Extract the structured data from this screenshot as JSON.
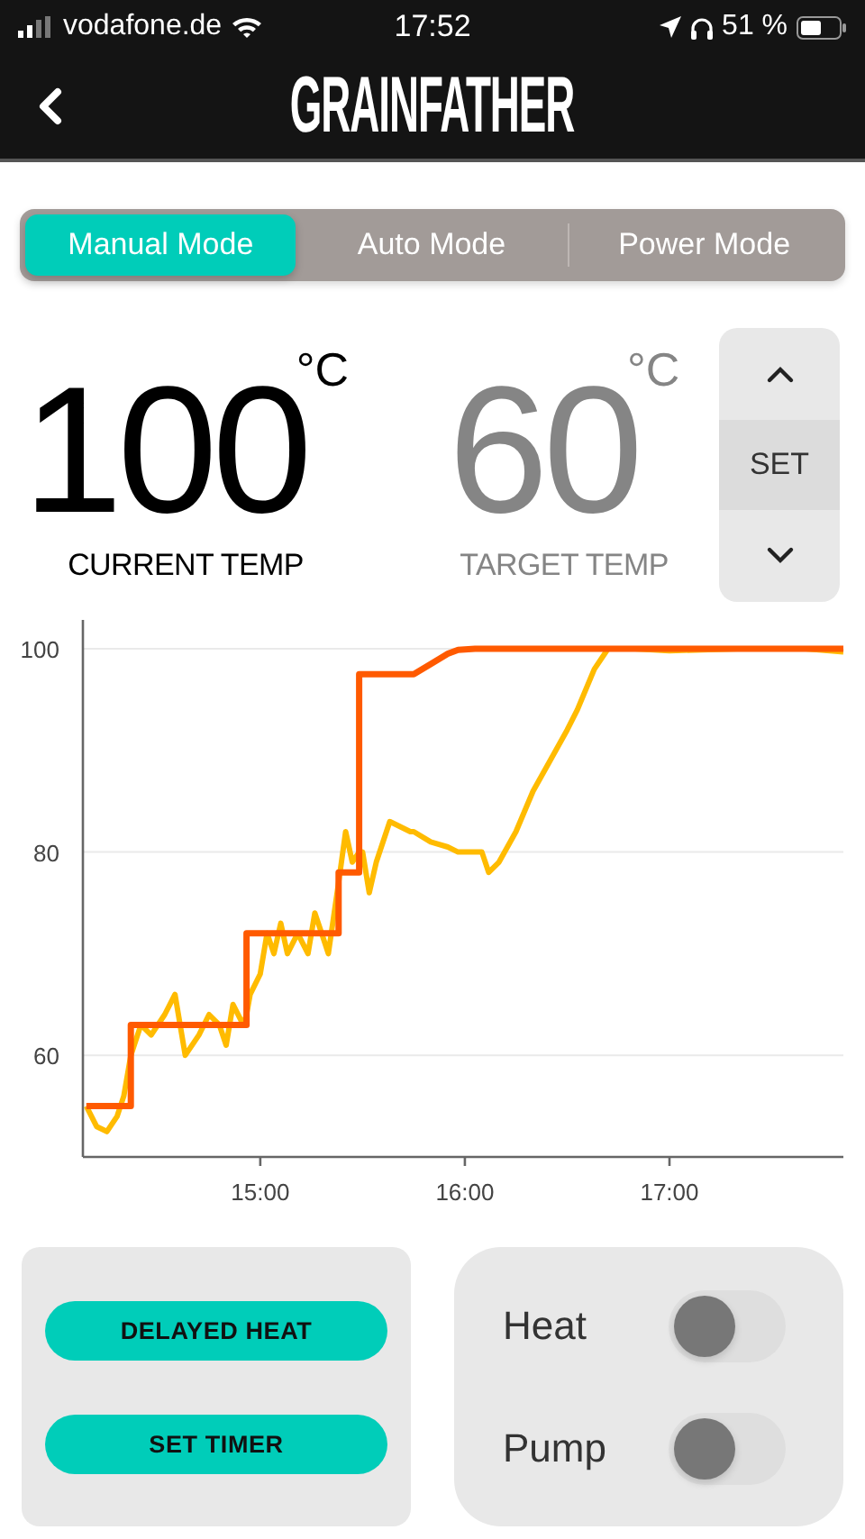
{
  "status_bar": {
    "carrier": "vodafone.de",
    "time": "17:52",
    "battery": "51 %"
  },
  "header": {
    "title": "GRAINFATHER"
  },
  "mode_tabs": [
    {
      "label": "Manual Mode",
      "selected": true
    },
    {
      "label": "Auto Mode",
      "selected": false
    },
    {
      "label": "Power Mode",
      "selected": false
    }
  ],
  "current": {
    "value": "100",
    "unit": "°C",
    "label": "CURRENT TEMP"
  },
  "target": {
    "value": "60",
    "unit": "°C",
    "label": "TARGET TEMP"
  },
  "setter": {
    "button": "SET"
  },
  "chart": {
    "chart_data": {
      "type": "line",
      "x": [
        14.15,
        14.2,
        14.25,
        14.3,
        14.333,
        14.367,
        14.367,
        14.417,
        14.467,
        14.533,
        14.583,
        14.633,
        14.7,
        14.75,
        14.8,
        14.833,
        14.867,
        14.917,
        14.933,
        14.933,
        14.95,
        15,
        15.033,
        15.067,
        15.1,
        15.133,
        15.183,
        15.233,
        15.267,
        15.3,
        15.333,
        15.383,
        15.383,
        15.417,
        15.45,
        15.483,
        15.483,
        15.5,
        15.533,
        15.567,
        15.633,
        15.733,
        15.75,
        15.833,
        15.917,
        15.967,
        16.05,
        16.083,
        16.117,
        16.167,
        16.25,
        16.333,
        16.417,
        16.5,
        16.55,
        16.633,
        16.7,
        16.833,
        17,
        17.333,
        17.667,
        17.85
      ],
      "series": [
        {
          "color": "#ffbb00",
          "values": [
            55,
            53,
            52.5,
            54,
            56,
            60,
            60,
            63,
            62,
            64,
            66,
            60,
            62,
            64,
            63,
            61,
            65,
            63,
            64,
            64,
            66,
            68,
            72,
            70,
            73,
            70,
            72,
            70,
            74,
            72,
            70,
            77,
            77,
            82,
            79,
            80,
            80,
            80,
            76,
            79,
            83,
            82,
            82,
            81,
            80.5,
            80,
            80,
            80,
            78,
            79,
            82,
            86,
            89,
            92,
            94,
            98,
            100,
            100,
            99.8,
            100,
            100,
            99.7
          ]
        },
        {
          "color": "#ff5a00",
          "values": [
            55,
            55,
            55,
            55,
            55,
            55,
            63,
            63,
            63,
            63,
            63,
            63,
            63,
            63,
            63,
            63,
            63,
            63,
            63,
            72,
            72,
            72,
            72,
            72,
            72,
            72,
            72,
            72,
            72,
            72,
            72,
            72,
            78,
            78,
            78,
            78,
            97.5,
            97.5,
            97.5,
            97.5,
            97.5,
            97.5,
            97.5,
            98.5,
            99.5,
            99.9,
            100,
            100,
            100,
            100,
            100,
            100,
            100,
            100,
            100,
            100,
            100,
            100,
            100,
            100,
            100,
            100
          ]
        }
      ],
      "xlim": [
        14.133,
        17.85
      ],
      "ylim": [
        50,
        102.8
      ],
      "xticks": [
        {
          "value": 15,
          "label": "15:00"
        },
        {
          "value": 16,
          "label": "16:00"
        },
        {
          "value": 17,
          "label": "17:00"
        }
      ],
      "yticks": [
        60,
        80,
        100
      ],
      "grid": true
    }
  },
  "buttons": [
    "DELAYED HEAT",
    "SET TIMER"
  ],
  "switches": [
    {
      "label": "Heat",
      "on": false
    },
    {
      "label": "Pump",
      "on": false
    }
  ]
}
